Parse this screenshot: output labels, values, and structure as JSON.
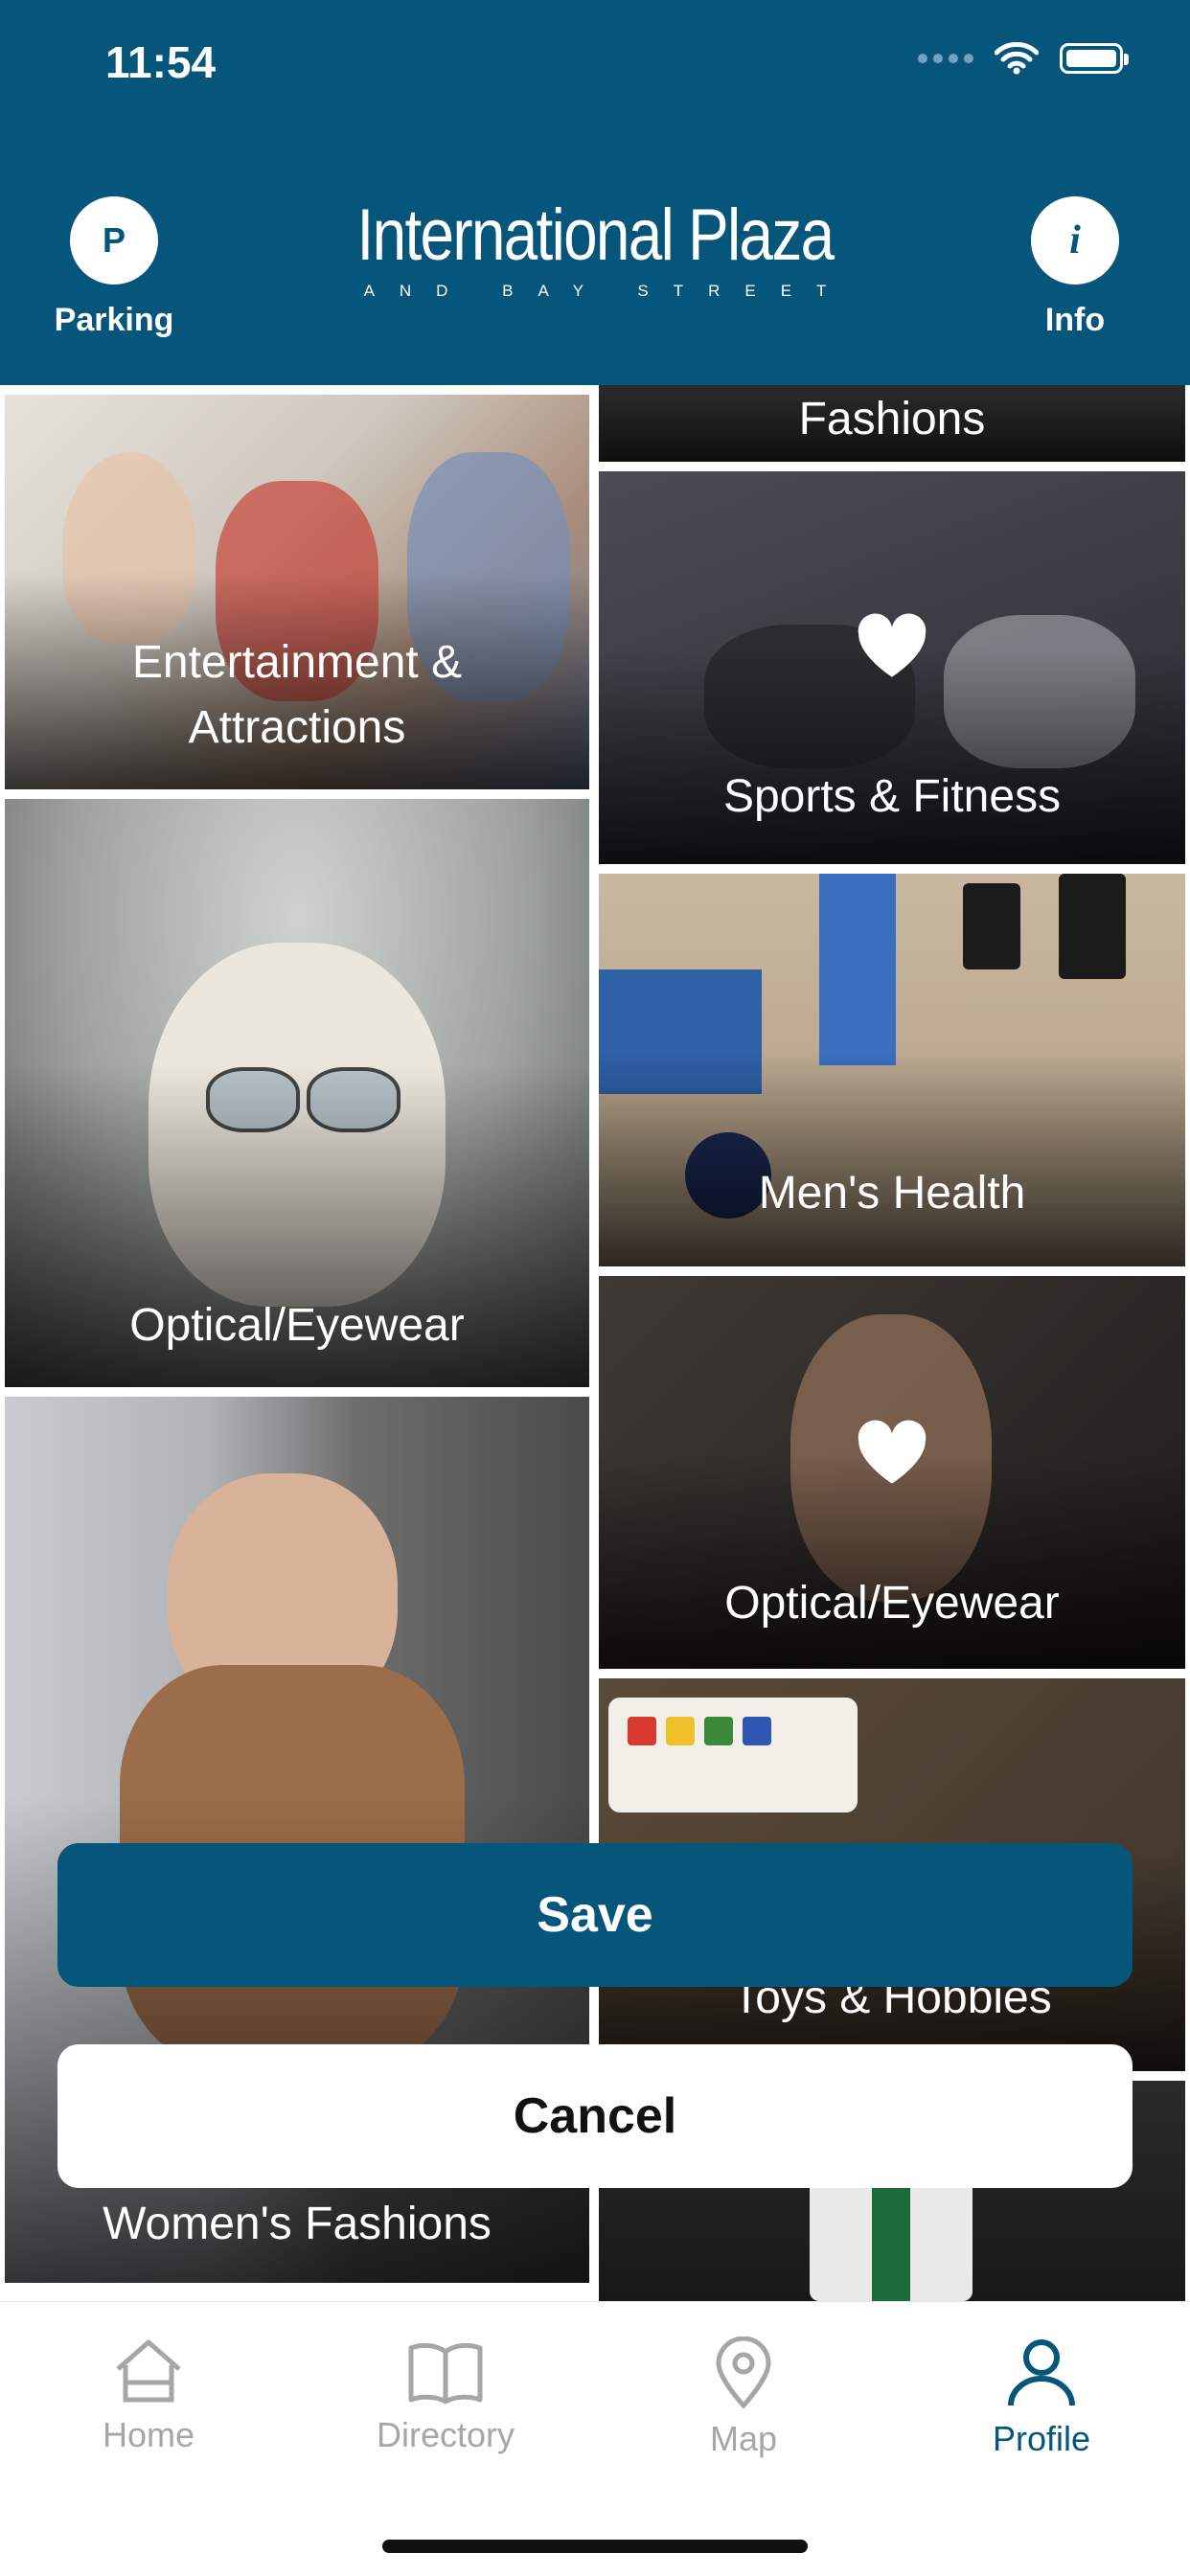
{
  "status": {
    "time": "11:54"
  },
  "header": {
    "parking": {
      "glyph": "P",
      "label": "Parking"
    },
    "logo": {
      "main": "International Plaza",
      "sub": "AND BAY STREET"
    },
    "info": {
      "glyph": "i",
      "label": "Info"
    }
  },
  "colors": {
    "brand": "#06557A",
    "inactive": "#A6A6A6"
  },
  "categories": {
    "fashions_partial": "Fashions",
    "entertainment": "Entertainment & Attractions",
    "sports": "Sports & Fitness",
    "optical_left": "Optical/Eyewear",
    "mens_health": "Men's Health",
    "optical_right": "Optical/Eyewear",
    "toys": "Toys & Hobbies",
    "womens": "Women's Fashions"
  },
  "actions": {
    "save": "Save",
    "cancel": "Cancel"
  },
  "tabs": [
    {
      "label": "Home",
      "icon": "home-icon",
      "active": false
    },
    {
      "label": "Directory",
      "icon": "book-icon",
      "active": false
    },
    {
      "label": "Map",
      "icon": "map-pin-icon",
      "active": false
    },
    {
      "label": "Profile",
      "icon": "user-icon",
      "active": true
    }
  ]
}
